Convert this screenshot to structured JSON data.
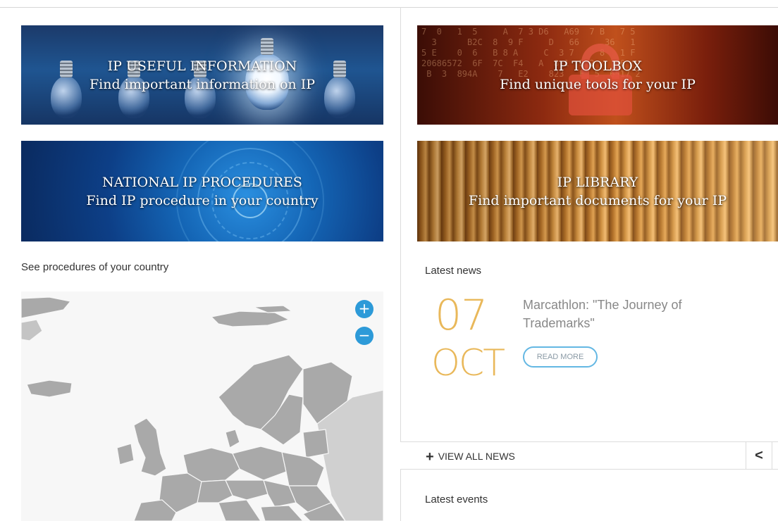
{
  "banners": {
    "useful_info": {
      "title": "IP USEFUL INFORMATION",
      "subtitle": "Find important information on IP"
    },
    "toolbox": {
      "title": "IP TOOLBOX",
      "subtitle": "Find unique tools for your IP"
    },
    "procedures": {
      "title": "NATIONAL IP PROCEDURES",
      "subtitle": "Find IP procedure in your country"
    },
    "library": {
      "title": "IP LIBRARY",
      "subtitle": "Find important documents for your IP"
    }
  },
  "map_section": {
    "caption": "See procedures of your country",
    "zoom_in": "+",
    "zoom_out": "−"
  },
  "news": {
    "heading": "Latest news",
    "item": {
      "day": "07",
      "month": "OCT",
      "title": "Marcathlon: \"The Journey of Trademarks\"",
      "read_more": "READ MORE"
    },
    "view_all": "VIEW ALL NEWS",
    "prev": "<"
  },
  "events": {
    "heading": "Latest events"
  },
  "colors": {
    "accent_blue": "#2d9ad8",
    "date_gold": "#e9b85a",
    "land_gray": "#a8a8a8"
  },
  "icons": [
    "plus-icon",
    "minus-icon",
    "chevron-left-icon"
  ]
}
